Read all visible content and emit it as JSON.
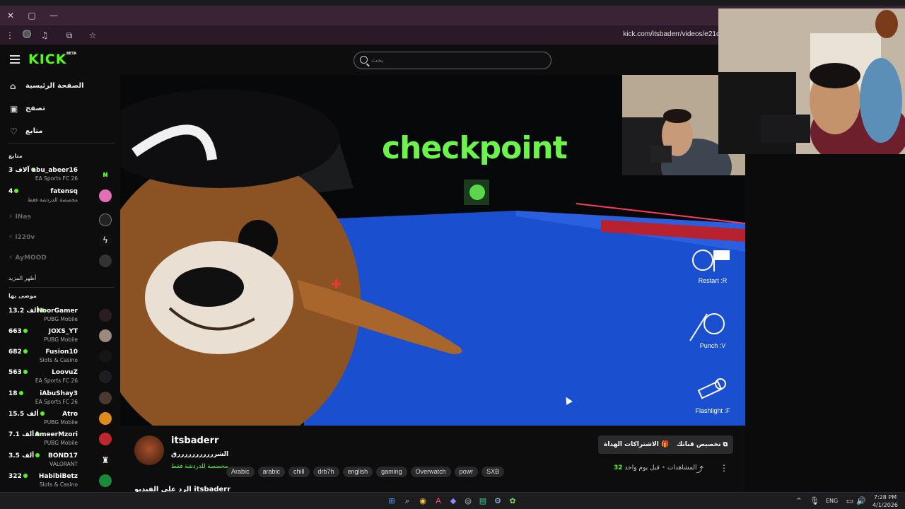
{
  "browser": {
    "url": "kick.com/itsbaderr/videos/e21c",
    "window_controls": {
      "close": "✕",
      "restore": "▢",
      "minimize": "—"
    }
  },
  "kick": {
    "logo": "KICK",
    "beta": "BETA",
    "search_placeholder": "بحث",
    "brand_color": "#53fc18"
  },
  "sidebar": {
    "nav": [
      {
        "label": "الصفحة الرئيسية",
        "icon": "home-icon"
      },
      {
        "label": "تصفح",
        "icon": "browse-icon"
      },
      {
        "label": "متابع",
        "icon": "heart-icon"
      }
    ],
    "following_title": "متابع",
    "following": [
      {
        "name": "abu_abeer16",
        "category": "EA Sports FC 26",
        "count": "3 آلاف",
        "live": true
      },
      {
        "name": "fatensq",
        "category": "مخصصة للدردشة فقط",
        "count": "4",
        "live": true
      },
      {
        "name": "INas",
        "category": "",
        "count": "",
        "live": false
      },
      {
        "name": "i220v",
        "category": "",
        "count": "",
        "live": false
      },
      {
        "name": "AyMOOD",
        "category": "",
        "count": "",
        "live": false
      }
    ],
    "show_more": "أظهر المزيد",
    "recommended_title": "موصى بها",
    "recommended": [
      {
        "name": "NoorGamer",
        "category": "PUBG Mobile",
        "count": "13.2 ألف"
      },
      {
        "name": "JOXS_YT",
        "category": "PUBG Mobile",
        "count": "663"
      },
      {
        "name": "Fusion10",
        "category": "Slots & Casino",
        "count": "682"
      },
      {
        "name": "LoovuZ",
        "category": "EA Sports FC 26",
        "count": "563"
      },
      {
        "name": "iAbuShay3",
        "category": "EA Sports FC 26",
        "count": "18"
      },
      {
        "name": "Atro",
        "category": "PUBG Mobile",
        "count": "15.5 ألف"
      },
      {
        "name": "AmeerMzori",
        "category": "PUBG Mobile",
        "count": "7.1 ألف"
      },
      {
        "name": "BOND17",
        "category": "VALORANT",
        "count": "3.5 ألف"
      },
      {
        "name": "HabibiBetz",
        "category": "Slots & Casino",
        "count": "322"
      }
    ]
  },
  "player": {
    "checkpoint": "checkpoint",
    "controls": [
      {
        "label": "Restart :R",
        "icon": "restart-icon"
      },
      {
        "label": "Punch :V",
        "icon": "punch-icon"
      },
      {
        "label": "Flashlight :F",
        "icon": "flashlight-icon"
      }
    ]
  },
  "video_info": {
    "channel": "itsbaderr",
    "title": "الشرررررررررررق",
    "category": "مخصصة للدردشة فقط",
    "tags": [
      "Arabic",
      "arabic",
      "chill",
      "drb7h",
      "english",
      "gaming",
      "Overwatch",
      "powr",
      "SXB"
    ],
    "subscribe_button": "الاشتراكات الهداة",
    "customize_button": "تخصيص قناتك",
    "views_label": "المشاهدات",
    "views_count": "32",
    "time_ago": "قبل يوم واحد",
    "separator": "•",
    "below_text": "الرد على الفيديو itsbaderr"
  },
  "taskbar": {
    "lang": "ENG",
    "time": "7:28 PM",
    "date": "4/1/2026"
  }
}
